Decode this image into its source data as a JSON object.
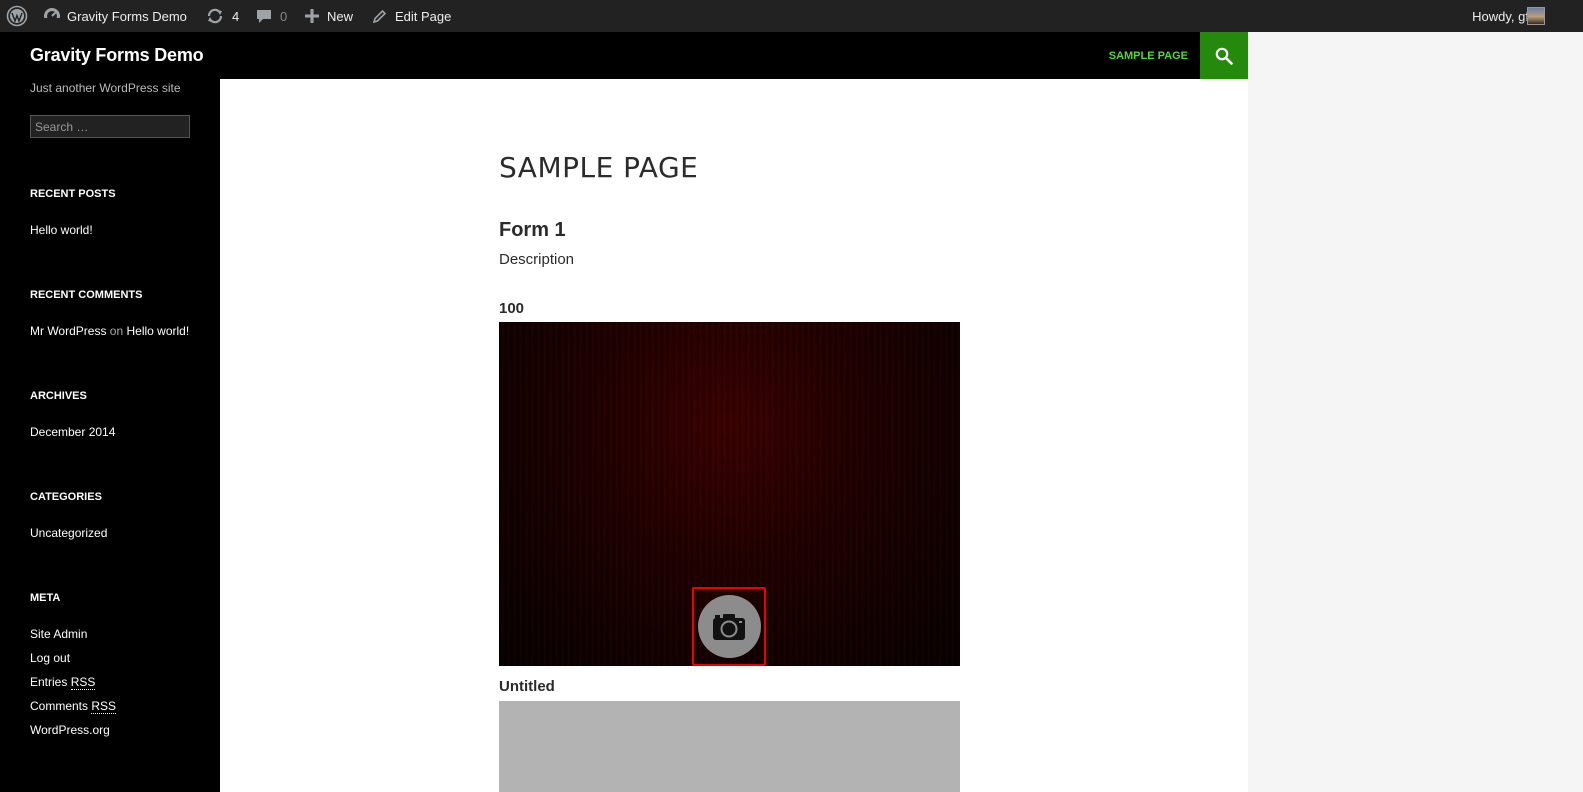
{
  "adminbar": {
    "site_name": "Gravity Forms Demo",
    "updates_count": "4",
    "comments_count": "0",
    "new_label": "New",
    "edit_label": "Edit Page",
    "howdy": "Howdy, gf"
  },
  "sidebar": {
    "site_title": "Gravity Forms Demo",
    "site_description": "Just another WordPress site",
    "search_placeholder": "Search …",
    "recent_posts": {
      "title": "RECENT POSTS",
      "items": [
        "Hello world!"
      ]
    },
    "recent_comments": {
      "title": "RECENT COMMENTS",
      "author": "Mr WordPress",
      "on": "on",
      "post": "Hello world!"
    },
    "archives": {
      "title": "ARCHIVES",
      "items": [
        "December 2014"
      ]
    },
    "categories": {
      "title": "CATEGORIES",
      "items": [
        "Uncategorized"
      ]
    },
    "meta": {
      "title": "META",
      "site_admin": "Site Admin",
      "log_out": "Log out",
      "entries_prefix": "Entries",
      "comments_prefix": "Comments",
      "rss": "RSS",
      "wordpress_org": "WordPress.org"
    }
  },
  "nav": {
    "sample_page": "SAMPLE PAGE"
  },
  "main": {
    "page_title": "SAMPLE PAGE",
    "form_title": "Form 1",
    "form_description": "Description",
    "field1_label": "100",
    "field2_label": "Untitled"
  },
  "colors": {
    "accent_green": "#24890d",
    "nav_green": "#55d737",
    "highlight_red": "#ee0000"
  }
}
